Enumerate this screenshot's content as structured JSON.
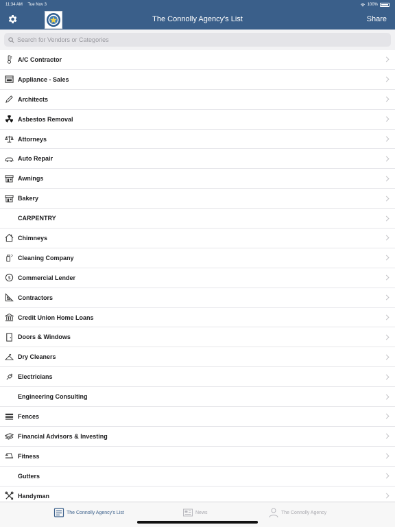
{
  "status": {
    "time": "11:34 AM",
    "date": "Tue Nov 3",
    "battery": "100%"
  },
  "nav": {
    "title": "The Connolly Agency's List",
    "share": "Share"
  },
  "search": {
    "placeholder": "Search for Vendors or Categories"
  },
  "categories": [
    {
      "label": "A/C Contractor",
      "icon": "thermometer-icon"
    },
    {
      "label": "Appliance - Sales",
      "icon": "appliance-icon"
    },
    {
      "label": "Architects",
      "icon": "pencil-icon"
    },
    {
      "label": "Asbestos Removal",
      "icon": "hazard-icon"
    },
    {
      "label": "Attorneys",
      "icon": "scales-icon"
    },
    {
      "label": "Auto Repair",
      "icon": "car-icon"
    },
    {
      "label": "Awnings",
      "icon": "storefront-icon"
    },
    {
      "label": "Bakery",
      "icon": "storefront-icon"
    },
    {
      "label": "CARPENTRY",
      "icon": ""
    },
    {
      "label": "Chimneys",
      "icon": "house-icon"
    },
    {
      "label": "Cleaning Company",
      "icon": "spray-bottle-icon"
    },
    {
      "label": "Commercial Lender",
      "icon": "dollar-coin-icon"
    },
    {
      "label": "Contractors",
      "icon": "set-square-icon"
    },
    {
      "label": "Credit Union Home Loans",
      "icon": "bank-icon"
    },
    {
      "label": "Doors & Windows",
      "icon": "door-icon"
    },
    {
      "label": "Dry Cleaners",
      "icon": "hanger-icon"
    },
    {
      "label": "Electricians",
      "icon": "plug-icon"
    },
    {
      "label": "Engineering Consulting",
      "icon": ""
    },
    {
      "label": "Fences",
      "icon": "fence-icon"
    },
    {
      "label": "Financial Advisors & Investing",
      "icon": "money-stack-icon"
    },
    {
      "label": "Fitness",
      "icon": "treadmill-icon"
    },
    {
      "label": "Gutters",
      "icon": ""
    },
    {
      "label": "Handyman",
      "icon": "tools-icon"
    }
  ],
  "tabs": [
    {
      "label": "The Connolly Agency's List",
      "icon": "list-icon",
      "active": true
    },
    {
      "label": "News",
      "icon": "newspaper-icon",
      "active": false
    },
    {
      "label": "The Connolly Agency",
      "icon": "person-icon",
      "active": false
    }
  ],
  "colors": {
    "header": "#3a5f8a",
    "tab_active": "#3a5f8a",
    "tab_inactive": "#a8a8ae"
  }
}
